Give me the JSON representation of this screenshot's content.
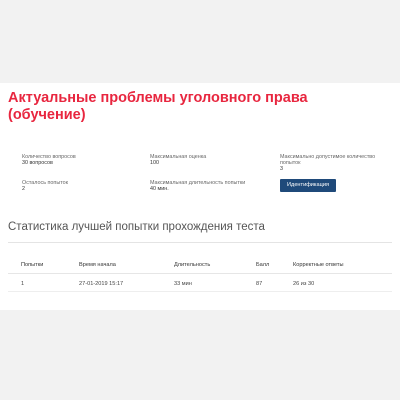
{
  "course": {
    "title": "Актуальные проблемы уголовного права (обучение)"
  },
  "info": {
    "questions_label": "Количество вопросов",
    "questions_value": "30 вопросов",
    "max_score_label": "Максимальная оценка",
    "max_score_value": "100",
    "max_attempts_label": "Максимально допустимое количество попыток",
    "max_attempts_value": "3",
    "attempts_left_label": "Осталось попыток",
    "attempts_left_value": "2",
    "max_duration_label": "Максимальная длительность попытки",
    "max_duration_value": "40 мин.",
    "identify_button": "Идентификация"
  },
  "stats": {
    "title": "Статистика лучшей попытки прохождения теста",
    "headers": [
      "Попытки",
      "Время начала",
      "Длительность",
      "Балл",
      "Корректные ответы"
    ],
    "rows": [
      [
        "1",
        "27-01-2019 15:17",
        "33 мин",
        "87",
        "26 из 30"
      ]
    ]
  },
  "colors": {
    "accent": "#e8263f",
    "button": "#1f4a7a"
  }
}
